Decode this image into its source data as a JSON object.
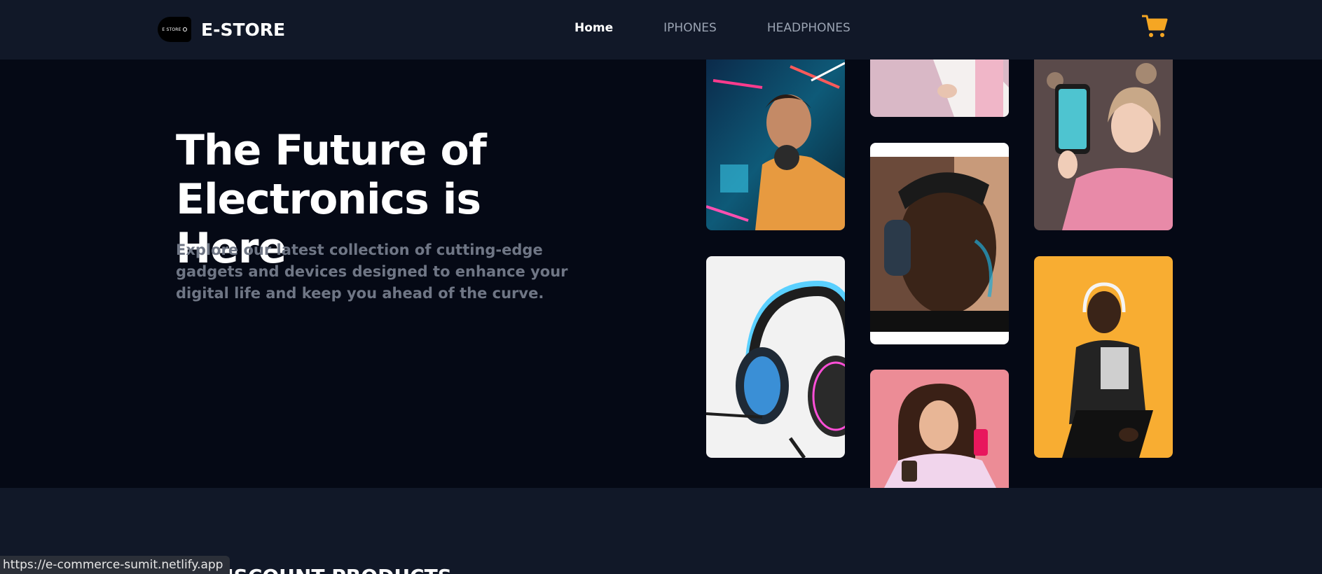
{
  "nav": {
    "logo_text": "E STORE",
    "brand": "E-STORE",
    "links": [
      {
        "label": "Home",
        "active": true
      },
      {
        "label": "IPHONES",
        "active": false
      },
      {
        "label": "HEADPHONES",
        "active": false
      }
    ],
    "cart_icon": "cart-icon",
    "cart_color": "#f5a623"
  },
  "hero": {
    "title": "The Future of Electronics is Here",
    "subtitle": "Explore our latest collection of cutting-edge gadgets and devices designed to enhance your digital life and keep you ahead of the curve."
  },
  "gallery": [
    {
      "subject": "man-with-headphones-neon"
    },
    {
      "subject": "gaming-headset-product"
    },
    {
      "subject": "person-in-white-shirt-pink"
    },
    {
      "subject": "man-wearing-headphones-closeup"
    },
    {
      "subject": "woman-taking-selfie-pink"
    },
    {
      "subject": "woman-holding-phone-pink-jacket"
    },
    {
      "subject": "man-with-headphones-orange"
    }
  ],
  "lower": {
    "section_title": "DISCOUNT PRODUCTS"
  },
  "status_bar": {
    "url": "https://e-commerce-sumit.netlify.app"
  }
}
